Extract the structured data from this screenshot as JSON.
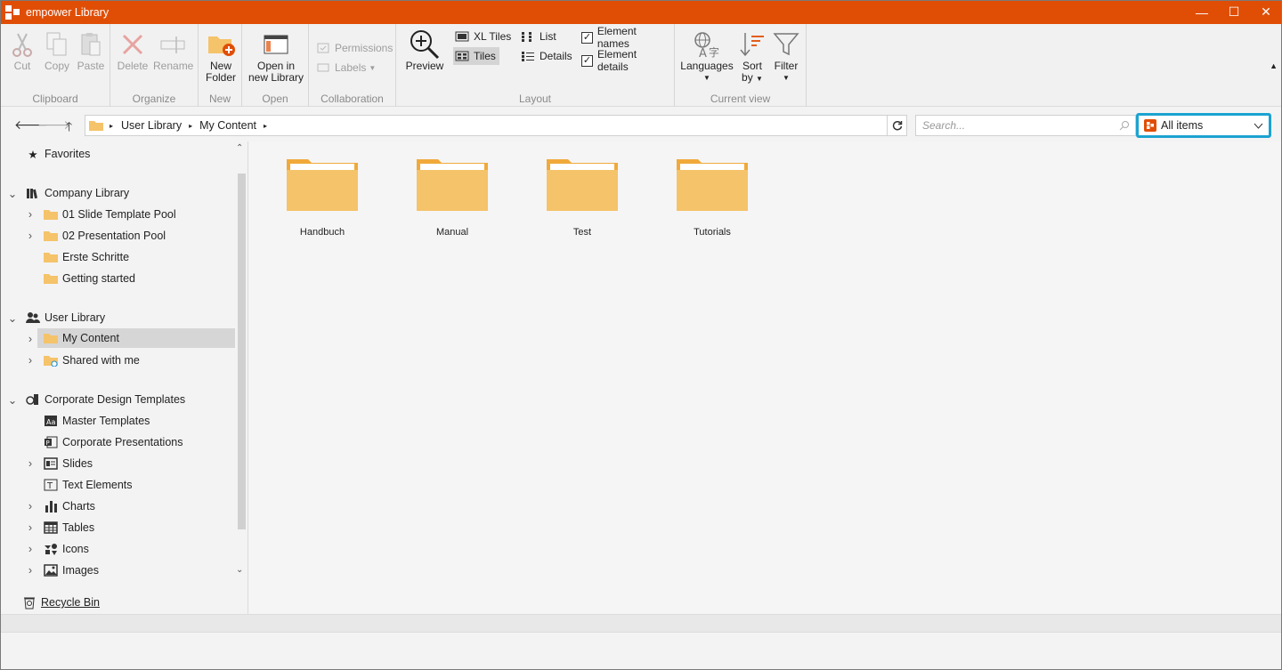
{
  "window": {
    "title": "empower Library",
    "minimize": "—",
    "maximize": "☐",
    "close": "✕"
  },
  "ribbon": {
    "clipboard": {
      "label": "Clipboard",
      "cut": "Cut",
      "copy": "Copy",
      "paste": "Paste"
    },
    "organize": {
      "label": "Organize",
      "delete": "Delete",
      "rename": "Rename"
    },
    "new": {
      "label": "New",
      "new_folder_line1": "New",
      "new_folder_line2": "Folder"
    },
    "open": {
      "label": "Open",
      "open_line1": "Open in",
      "open_line2": "new Library"
    },
    "collaboration": {
      "label": "Collaboration",
      "permissions": "Permissions",
      "labels": "Labels"
    },
    "layout": {
      "label": "Layout",
      "preview": "Preview",
      "xl_tiles": "XL Tiles",
      "tiles": "Tiles",
      "list": "List",
      "details": "Details",
      "element_names": "Element names",
      "element_details": "Element details",
      "element_names_checked": true,
      "element_details_checked": true
    },
    "current_view": {
      "label": "Current view",
      "languages": "Languages",
      "sort_line1": "Sort",
      "sort_line2": "by",
      "filter": "Filter"
    }
  },
  "address": {
    "breadcrumb": [
      "User Library",
      "My Content"
    ],
    "search_placeholder": "Search...",
    "filter_value": "All items"
  },
  "sidebar": {
    "favorites": "Favorites",
    "company_library": "Company Library",
    "company_items": [
      "01 Slide Template Pool",
      "02 Presentation Pool",
      "Erste Schritte",
      "Getting started"
    ],
    "user_library": "User Library",
    "user_items": [
      "My Content",
      "Shared with me"
    ],
    "corporate": "Corporate Design Templates",
    "corporate_items": [
      "Master Templates",
      "Corporate Presentations",
      "Slides",
      "Text Elements",
      "Charts",
      "Tables",
      "Icons",
      "Images"
    ],
    "recycle_bin": "Recycle Bin"
  },
  "content": {
    "tiles": [
      "Handbuch",
      "Manual",
      "Test",
      "Tutorials"
    ]
  },
  "colors": {
    "accent": "#e04e06",
    "highlight": "#1ba3d0",
    "folder": "#f5c36a"
  }
}
